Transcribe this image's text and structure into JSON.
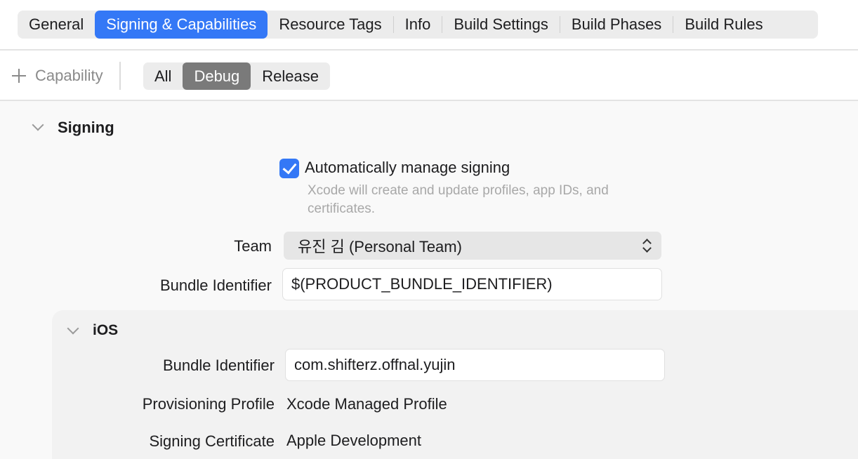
{
  "tabs": [
    {
      "label": "General"
    },
    {
      "label": "Signing & Capabilities",
      "active": true
    },
    {
      "label": "Resource Tags"
    },
    {
      "label": "Info"
    },
    {
      "label": "Build Settings"
    },
    {
      "label": "Build Phases"
    },
    {
      "label": "Build Rules"
    }
  ],
  "toolbar": {
    "add_capability_label": "Capability",
    "segments": [
      {
        "label": "All"
      },
      {
        "label": "Debug",
        "active": true
      },
      {
        "label": "Release"
      }
    ]
  },
  "signing": {
    "title": "Signing",
    "auto_manage": {
      "label": "Automatically manage signing",
      "checked": true,
      "help": "Xcode will create and update profiles, app IDs, and certificates."
    },
    "team_label": "Team",
    "team_value": "유진 김 (Personal Team)",
    "bundle_id_label": "Bundle Identifier",
    "bundle_id_value": "$(PRODUCT_BUNDLE_IDENTIFIER)"
  },
  "ios": {
    "title": "iOS",
    "bundle_id_label": "Bundle Identifier",
    "bundle_id_value": "com.shifterz.offnal.yujin",
    "provisioning_label": "Provisioning Profile",
    "provisioning_value": "Xcode Managed Profile",
    "certificate_label": "Signing Certificate",
    "certificate_value": "Apple Development"
  },
  "colors": {
    "accent": "#3478f6",
    "segment_active": "#7a7a7a"
  }
}
